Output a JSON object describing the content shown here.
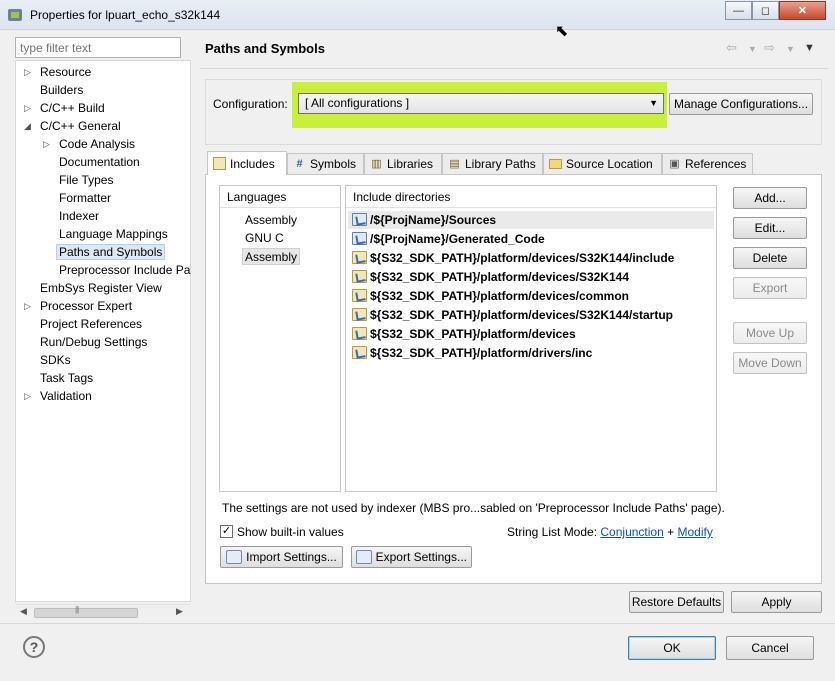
{
  "window": {
    "title": "Properties for lpuart_echo_s32k144",
    "minimize": "—",
    "restore": "◻",
    "close": "✕"
  },
  "sidebar": {
    "filter_placeholder": "type filter text",
    "items": [
      {
        "label": "Resource",
        "arrow": "▷"
      },
      {
        "label": "Builders"
      },
      {
        "label": "C/C++ Build",
        "arrow": "▷"
      },
      {
        "label": "C/C++ General",
        "arrow": "◢"
      },
      {
        "label": "Code Analysis",
        "arrow": "▷"
      },
      {
        "label": "Documentation"
      },
      {
        "label": "File Types"
      },
      {
        "label": "Formatter"
      },
      {
        "label": "Indexer"
      },
      {
        "label": "Language Mappings"
      },
      {
        "label": "Paths and Symbols"
      },
      {
        "label": "Preprocessor Include Pa"
      },
      {
        "label": "EmbSys Register View"
      },
      {
        "label": "Processor Expert",
        "arrow": "▷"
      },
      {
        "label": "Project References"
      },
      {
        "label": "Run/Debug Settings"
      },
      {
        "label": "SDKs"
      },
      {
        "label": "Task Tags"
      },
      {
        "label": "Validation",
        "arrow": "▷"
      }
    ]
  },
  "header": {
    "title": "Paths and Symbols"
  },
  "config": {
    "label": "Configuration:",
    "selected": "[ All configurations ]",
    "manage_button": "Manage Configurations..."
  },
  "tabs": [
    {
      "label": "Includes",
      "icon": "includes-icon"
    },
    {
      "label": "Symbols",
      "icon": "hash-icon"
    },
    {
      "label": "Libraries",
      "icon": "library-icon"
    },
    {
      "label": "Library Paths",
      "icon": "library-path-icon"
    },
    {
      "label": "Source Location",
      "icon": "folder-icon"
    },
    {
      "label": "References",
      "icon": "references-icon"
    }
  ],
  "languages": {
    "header": "Languages",
    "items": [
      "Assembly",
      "GNU C",
      "Assembly"
    ]
  },
  "include_dirs": {
    "header": "Include directories",
    "items": [
      "/${ProjName}/Sources",
      "/${ProjName}/Generated_Code",
      "${S32_SDK_PATH}/platform/devices/S32K144/include",
      "${S32_SDK_PATH}/platform/devices/S32K144",
      "${S32_SDK_PATH}/platform/devices/common",
      "${S32_SDK_PATH}/platform/devices/S32K144/startup",
      "${S32_SDK_PATH}/platform/devices",
      "${S32_SDK_PATH}/platform/drivers/inc"
    ]
  },
  "side_buttons": {
    "add": "Add...",
    "edit": "Edit...",
    "delete": "Delete",
    "export": "Export",
    "move_up": "Move Up",
    "move_down": "Move Down"
  },
  "note": "The settings are not used by indexer (MBS pro...sabled on 'Preprocessor Include Paths' page).",
  "show_builtin": {
    "label": "Show built-in values",
    "checked": "✓"
  },
  "string_list_mode": {
    "label": "String List Mode:",
    "conjunction": "Conjunction",
    "plus": "+",
    "modify": "Modify"
  },
  "import_button": "Import Settings...",
  "export_button": "Export Settings...",
  "restore_defaults": "Restore Defaults",
  "apply": "Apply",
  "ok": "OK",
  "cancel": "Cancel",
  "help": "?",
  "colors": {
    "highlight": "#c8f03a",
    "link": "#0b4fb4"
  }
}
